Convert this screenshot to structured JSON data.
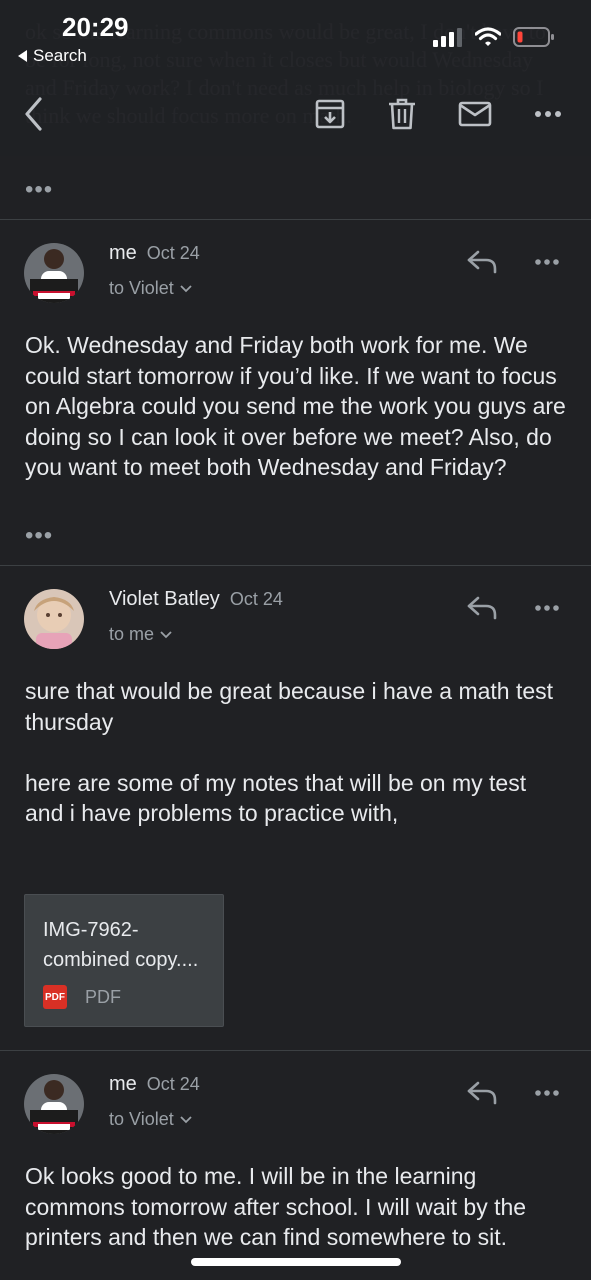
{
  "status_bar": {
    "time": "20:29",
    "back_app_label": "Search",
    "icons": [
      "signal-icon",
      "wifi-icon",
      "battery-icon"
    ]
  },
  "quoted_background_text": "ok so the learning commons would be great, I don't have to be for long, not sure when it closes but would Wednesday and Friday work? I don't need as much help in biology so I think we should focus more on math.",
  "toolbar": {
    "icons": [
      "back-icon",
      "archive-icon",
      "delete-icon",
      "mark-unread-icon",
      "more-icon"
    ]
  },
  "quoted_more": "•••",
  "messages": [
    {
      "sender": "me",
      "date": "Oct 24",
      "recipient": "to Violet",
      "body": "Ok. Wednesday and Friday both work for me. We could start tomorrow if you’d like. If we want to focus on Algebra could you send me the work you guys are doing so I can look it over before we meet? Also, do you want to meet both Wednesday and Friday?",
      "trimmed": "•••"
    },
    {
      "sender": "Violet Batley",
      "date": "Oct 24",
      "recipient": "to me",
      "body": "sure that would be great because i have a math test thursday\n\nhere are some of my notes that will be on my test and i have problems to practice with,",
      "attachment": {
        "name": "IMG-7962-combined copy....",
        "badge": "PDF",
        "type": "PDF"
      }
    },
    {
      "sender": "me",
      "date": "Oct 24",
      "recipient": "to Violet",
      "body": "Ok looks good to me. I will be in the learning commons tomorrow after school. I will wait by the printers and then we can find somewhere to sit."
    }
  ],
  "colors": {
    "background": "#202124",
    "text": "#e8eaed",
    "secondary_text": "#9aa0a6",
    "divider": "#3c4043",
    "attachment_bg": "#3c4043",
    "pdf_red": "#d93025",
    "battery_red": "#ff453a"
  }
}
